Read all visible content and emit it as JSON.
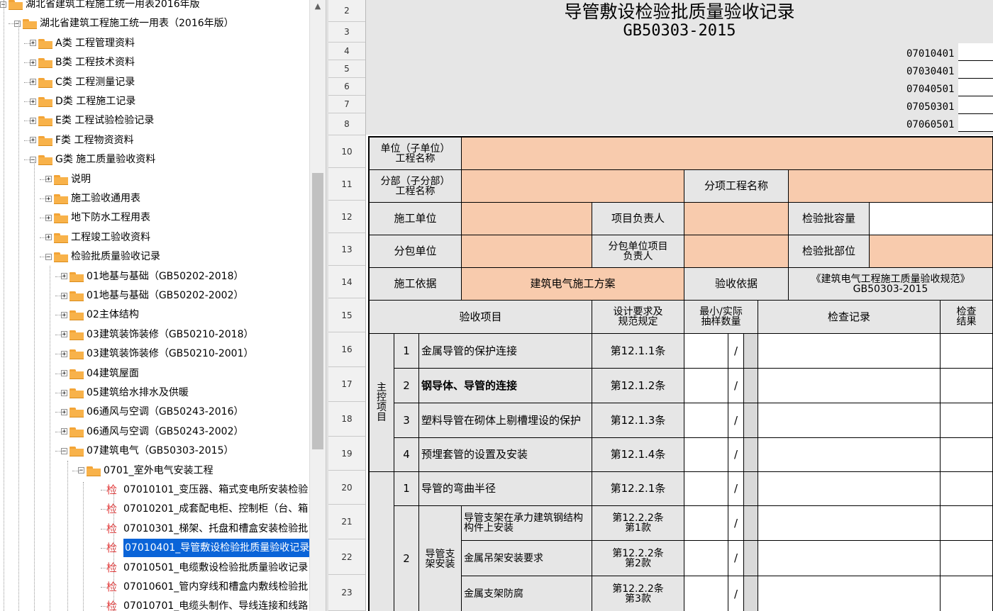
{
  "tree": {
    "items": [
      {
        "label": "湖北省建筑工程施工统一用表2016年版",
        "type": "folder",
        "open": true,
        "level": 0
      },
      {
        "label": "湖北省建筑工程施工统一用表（2016年版）",
        "type": "folder",
        "open": true,
        "level": 1
      },
      {
        "label": "A类 工程管理资料",
        "type": "folder",
        "open": false,
        "level": 2
      },
      {
        "label": "B类 工程技术资料",
        "type": "folder",
        "open": false,
        "level": 2
      },
      {
        "label": "C类 工程测量记录",
        "type": "folder",
        "open": false,
        "level": 2
      },
      {
        "label": "D类 工程施工记录",
        "type": "folder",
        "open": false,
        "level": 2
      },
      {
        "label": "E类 工程试验检验记录",
        "type": "folder",
        "open": false,
        "level": 2
      },
      {
        "label": "F类 工程物资资料",
        "type": "folder",
        "open": false,
        "level": 2
      },
      {
        "label": "G类 施工质量验收资料",
        "type": "folder",
        "open": true,
        "level": 2
      },
      {
        "label": "说明",
        "type": "folder",
        "open": false,
        "level": 3
      },
      {
        "label": "施工验收通用表",
        "type": "folder",
        "open": false,
        "level": 3
      },
      {
        "label": "地下防水工程用表",
        "type": "folder",
        "open": false,
        "level": 3
      },
      {
        "label": "工程竣工验收资料",
        "type": "folder",
        "open": false,
        "level": 3
      },
      {
        "label": "检验批质量验收记录",
        "type": "folder",
        "open": true,
        "level": 3
      },
      {
        "label": "01地基与基础（GB50202-2018）",
        "type": "folder",
        "open": false,
        "level": 4
      },
      {
        "label": "01地基与基础（GB50202-2002）",
        "type": "folder",
        "open": false,
        "level": 4
      },
      {
        "label": "02主体结构",
        "type": "folder",
        "open": false,
        "level": 4
      },
      {
        "label": "03建筑装饰装修（GB50210-2018）",
        "type": "folder",
        "open": false,
        "level": 4
      },
      {
        "label": "03建筑装饰装修（GB50210-2001）",
        "type": "folder",
        "open": false,
        "level": 4
      },
      {
        "label": "04建筑屋面",
        "type": "folder",
        "open": false,
        "level": 4
      },
      {
        "label": "05建筑给水排水及供暖",
        "type": "folder",
        "open": false,
        "level": 4
      },
      {
        "label": "06通风与空调（GB50243-2016）",
        "type": "folder",
        "open": false,
        "level": 4
      },
      {
        "label": "06通风与空调（GB50243-2002）",
        "type": "folder",
        "open": false,
        "level": 4
      },
      {
        "label": "07建筑电气（GB50303-2015）",
        "type": "folder",
        "open": true,
        "level": 4
      },
      {
        "label": "0701_室外电气安装工程",
        "type": "folder",
        "open": true,
        "level": 5
      },
      {
        "label": "07010101_变压器、箱式变电所安装检验",
        "type": "doc",
        "level": 6
      },
      {
        "label": "07010201_成套配电柜、控制柜（台、箱",
        "type": "doc",
        "level": 6
      },
      {
        "label": "07010301_梯架、托盘和槽盒安装检验批",
        "type": "doc",
        "level": 6
      },
      {
        "label": "07010401_导管敷设检验批质量验收记录",
        "type": "doc",
        "level": 6,
        "selected": true
      },
      {
        "label": "07010501_电缆敷设检验批质量验收记录",
        "type": "doc",
        "level": 6
      },
      {
        "label": "07010601_管内穿线和槽盒内敷线检验批",
        "type": "doc",
        "level": 6
      },
      {
        "label": "07010701_电缆头制作、导线连接和线路",
        "type": "doc",
        "level": 6
      }
    ],
    "doc_icon_glyph": "检"
  },
  "sheet": {
    "row_numbers": [
      "2",
      "3",
      "4",
      "5",
      "6",
      "7",
      "8",
      "10",
      "11",
      "12",
      "13",
      "14",
      "15",
      "16",
      "17",
      "18",
      "19",
      "20",
      "21",
      "22",
      "23"
    ],
    "title": "导管敷设检验批质量验收记录",
    "standard": "GB50303-2015",
    "codes": [
      "07010401",
      "07030401",
      "07040501",
      "07050301",
      "07060501"
    ],
    "labels": {
      "unit_project": "单位（子单位）\n工程名称",
      "sub_project": "分部（子分部）\n工程名称",
      "item_project": "分项工程名称",
      "constructor": "施工单位",
      "project_manager": "项目负责人",
      "batch_capacity": "检验批容量",
      "subcontractor": "分包单位",
      "sub_manager": "分包单位项目\n负责人",
      "batch_location": "检验批部位",
      "basis": "施工依据",
      "basis_value": "建筑电气施工方案",
      "acceptance_basis": "验收依据",
      "acceptance_basis_value": "《建筑电气工程施工质量验收规范》\nGB50303-2015",
      "col_item": "验收项目",
      "col_design": "设计要求及\n规范规定",
      "col_sample": "最小/实际\n抽样数量",
      "col_record": "检查记录",
      "col_result": "检查\n结果",
      "main_control": "主\n控\n项\n目",
      "support_install": "导管支\n架安装"
    },
    "main_items": [
      {
        "no": "1",
        "name": "金属导管的保护连接",
        "clause": "第12.1.1条",
        "slash": "/"
      },
      {
        "no": "2",
        "name": "钢导体、导管的连接",
        "clause": "第12.1.2条",
        "slash": "/"
      },
      {
        "no": "3",
        "name": "塑料导管在砌体上剔槽埋设的保护",
        "clause": "第12.1.3条",
        "slash": "/"
      },
      {
        "no": "4",
        "name": "预埋套管的设置及安装",
        "clause": "第12.1.4条",
        "slash": "/"
      }
    ],
    "general_items": [
      {
        "no": "1",
        "name": "导管的弯曲半径",
        "clause": "第12.2.1条",
        "slash": "/"
      }
    ],
    "support_items": [
      {
        "no": "2",
        "name": "导管支架在承力建筑钢结构构件上安装",
        "clause": "第12.2.2条\n第1款",
        "slash": "/"
      },
      {
        "name": "金属吊架安装要求",
        "clause": "第12.2.2条\n第2款",
        "slash": "/"
      },
      {
        "name": "金属支架防腐",
        "clause": "第12.2.2条\n第3款",
        "slash": "/"
      }
    ]
  }
}
